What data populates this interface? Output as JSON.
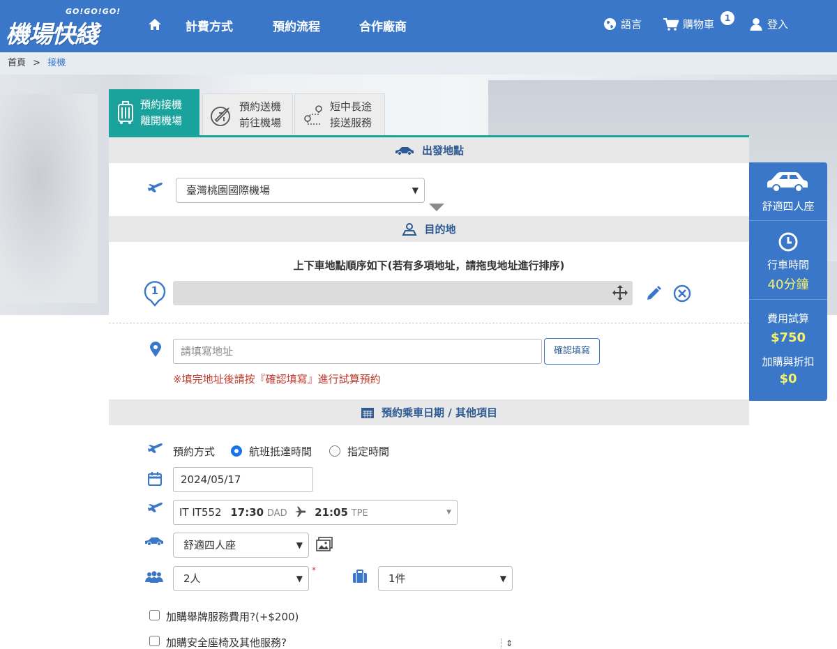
{
  "header": {
    "logo_small": "GO!GO!GO!",
    "logo_big": "機場快綫",
    "nav": [
      "計費方式",
      "預約流程",
      "合作廠商"
    ],
    "language": "語言",
    "cart": "購物車",
    "cart_count": "1",
    "login": "登入"
  },
  "breadcrumb": {
    "home": "首頁",
    "sep": ">",
    "current": "接機"
  },
  "tabs": [
    {
      "line1": "預約接機",
      "line2": "離開機場"
    },
    {
      "line1": "預約送機",
      "line2": "前往機場"
    },
    {
      "line1": "短中長途",
      "line2": "接送服務"
    }
  ],
  "departure": {
    "title": "出發地點",
    "airport": "臺灣桃園國際機場"
  },
  "destination": {
    "title": "目的地",
    "instruction": "上下車地點順序如下(若有多項地址，請拖曳地址進行排序)",
    "stop_number": "1",
    "address_placeholder": "請填寫地址",
    "confirm_button": "確認填寫",
    "warning": "※填完地址後請按『確認填寫』進行試算預約"
  },
  "booking": {
    "title": "預約乘車日期 / 其他項目",
    "method_label": "預約方式",
    "method_options": [
      "航班抵達時間",
      "指定時間"
    ],
    "date": "2024/05/17",
    "flight": {
      "code": "IT IT552",
      "dep_time": "17:30",
      "dep_airport": "DAD",
      "arr_time": "21:05",
      "arr_airport": "TPE"
    },
    "car_type": "舒適四人座",
    "passengers": "2人",
    "luggage": "1件",
    "addon1": "加購舉牌服務費用?(+$200)",
    "addon2": "加購安全座椅及其他服務?"
  },
  "summary": {
    "car": "舒適四人座",
    "time_label": "行車時間",
    "time_value": "40分鐘",
    "fee_label": "費用試算",
    "fee_value": "$750",
    "discount_label": "加購與折扣",
    "discount_value": "$0"
  },
  "colors": {
    "primary": "#3a77c8",
    "teal": "#1aa39c",
    "warning": "#c0392b",
    "yellow": "#f6f06a"
  }
}
